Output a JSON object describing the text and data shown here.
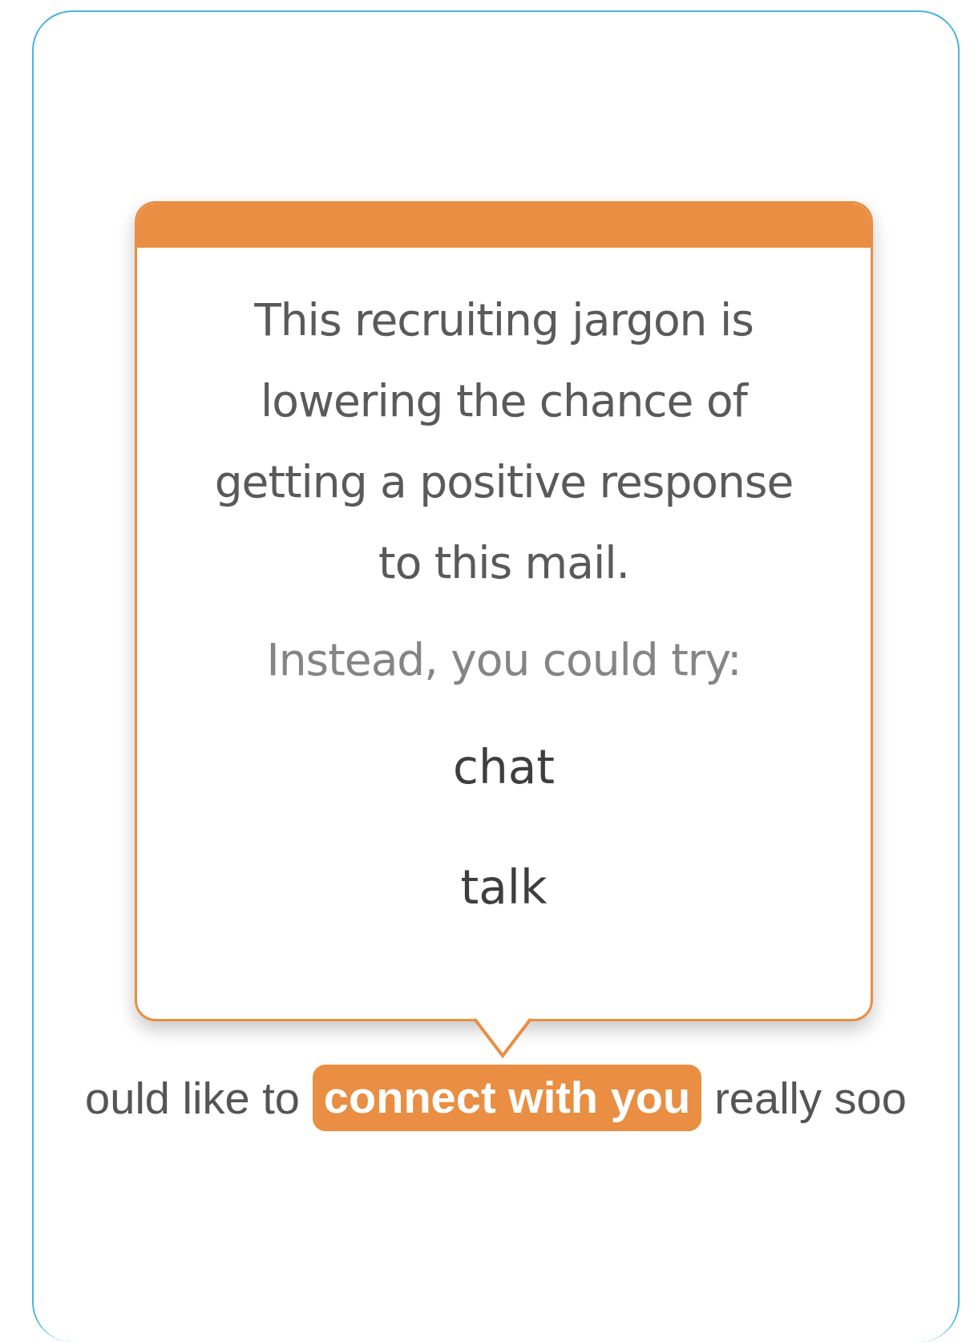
{
  "tooltip": {
    "message": "This recruiting jargon is lowering the chance of getting a positive response to this mail.",
    "prompt": "Instead, you could try:",
    "suggestions": [
      {
        "text": "chat"
      },
      {
        "text": "talk"
      }
    ]
  },
  "sentence": {
    "before": "ould like to",
    "highlight": "connect with you",
    "after": "really soo"
  }
}
